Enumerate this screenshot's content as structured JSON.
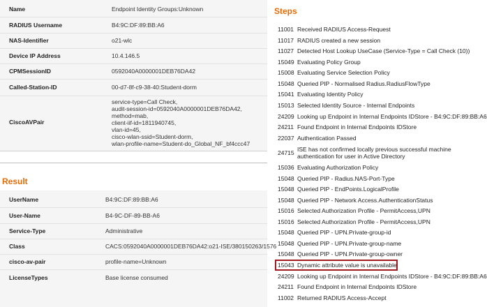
{
  "details": {
    "rows": [
      {
        "label": "Name",
        "value": "Endpoint Identity Groups:Unknown"
      },
      {
        "label": "RADIUS Username",
        "value": "B4:9C:DF:89:BB:A6"
      },
      {
        "label": "NAS-Identifier",
        "value": "o21-wlc"
      },
      {
        "label": "Device IP Address",
        "value": "10.4.146.5"
      },
      {
        "label": "CPMSessionID",
        "value": "0592040A0000001DEB76DA42"
      },
      {
        "label": "Called-Station-ID",
        "value": "00-d7-8f-c9-38-40:Student-dorm"
      },
      {
        "label": "CiscoAVPair",
        "value": "service-type=Call Check,\naudit-session-id=0592040A0000001DEB76DA42,\nmethod=mab,\nclient-iif-id=1811940745,\nvlan-id=45,\ncisco-wlan-ssid=Student-dorm,\nwlan-profile-name=Student-do_Global_NF_bf4ccc47"
      }
    ]
  },
  "result": {
    "heading": "Result",
    "rows": [
      {
        "label": "UserName",
        "value": "B4:9C:DF:89:BB:A6"
      },
      {
        "label": "User-Name",
        "value": "B4-9C-DF-89-BB-A6"
      },
      {
        "label": "Service-Type",
        "value": "Administrative"
      },
      {
        "label": "Class",
        "value": "CACS:0592040A0000001DEB76DA42:o21-ISE/380150263/1576"
      },
      {
        "label": "cisco-av-pair",
        "value": "profile-name=Unknown"
      },
      {
        "label": "LicenseTypes",
        "value": "Base license consumed"
      }
    ]
  },
  "steps": {
    "heading": "Steps",
    "items": [
      {
        "code": "11001",
        "text": "Received RADIUS Access-Request"
      },
      {
        "code": "11017",
        "text": "RADIUS created a new session"
      },
      {
        "code": "11027",
        "text": "Detected Host Lookup UseCase (Service-Type = Call Check (10))"
      },
      {
        "code": "15049",
        "text": "Evaluating Policy Group"
      },
      {
        "code": "15008",
        "text": "Evaluating Service Selection Policy"
      },
      {
        "code": "15048",
        "text": "Queried PIP - Normalised Radius.RadiusFlowType"
      },
      {
        "code": "15041",
        "text": "Evaluating Identity Policy"
      },
      {
        "code": "15013",
        "text": "Selected Identity Source - Internal Endpoints"
      },
      {
        "code": "24209",
        "text": "Looking up Endpoint in Internal Endpoints IDStore - B4:9C:DF:89:BB:A6"
      },
      {
        "code": "24211",
        "text": "Found Endpoint in Internal Endpoints IDStore"
      },
      {
        "code": "22037",
        "text": "Authentication Passed"
      },
      {
        "code": "24715",
        "text": "ISE has not confirmed locally previous successful machine authentication for user in Active Directory"
      },
      {
        "code": "15036",
        "text": "Evaluating Authorization Policy"
      },
      {
        "code": "15048",
        "text": "Queried PIP - Radius.NAS-Port-Type"
      },
      {
        "code": "15048",
        "text": "Queried PIP - EndPoints.LogicalProfile"
      },
      {
        "code": "15048",
        "text": "Queried PIP - Network Access.AuthenticationStatus"
      },
      {
        "code": "15016",
        "text": "Selected Authorization Profile - PermitAccess,UPN"
      },
      {
        "code": "15016",
        "text": "Selected Authorization Profile - PermitAccess,UPN"
      },
      {
        "code": "15048",
        "text": "Queried PIP - UPN.Private-group-id"
      },
      {
        "code": "15048",
        "text": "Queried PIP - UPN.Private-group-name"
      },
      {
        "code": "15048",
        "text": "Queried PIP - UPN.Private-group-owner"
      },
      {
        "code": "15043",
        "text": "Dynamic attribute value is unavailable"
      },
      {
        "code": "24209",
        "text": "Looking up Endpoint in Internal Endpoints IDStore - B4:9C:DF:89:BB:A6"
      },
      {
        "code": "24211",
        "text": "Found Endpoint in Internal Endpoints IDStore"
      },
      {
        "code": "11002",
        "text": "Returned RADIUS Access-Accept"
      }
    ],
    "highlighted_code": "15043"
  },
  "colors": {
    "heading_orange": "#e36c09",
    "highlight_border": "#a0191e",
    "panel_bg": "#f5f5f5"
  }
}
